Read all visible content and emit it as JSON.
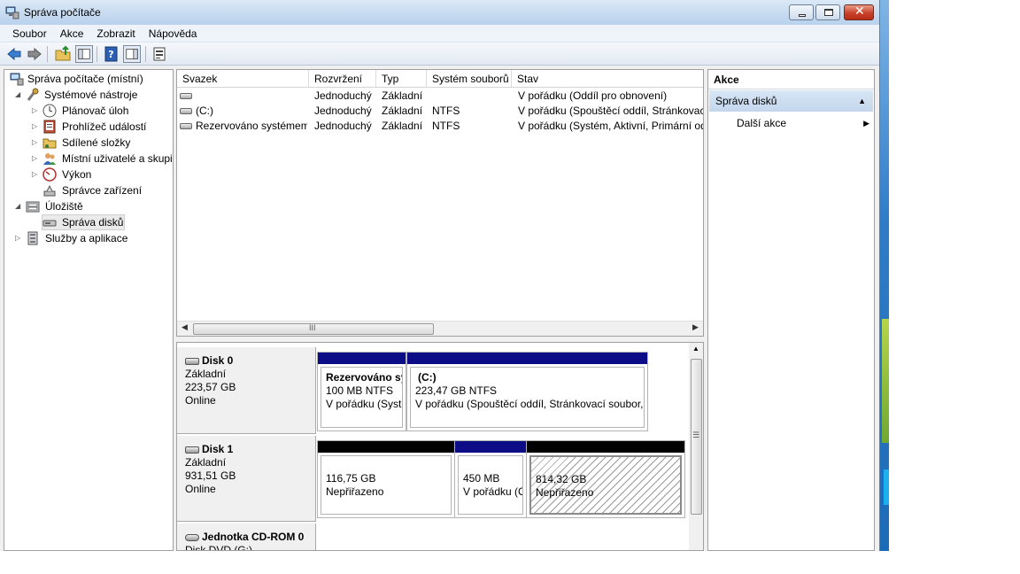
{
  "window": {
    "title": "Správa počítače"
  },
  "menu": [
    "Soubor",
    "Akce",
    "Zobrazit",
    "Nápověda"
  ],
  "tree": {
    "root": "Správa počítače (místní)",
    "system_tools": "Systémové nástroje",
    "task_scheduler": "Plánovač úloh",
    "event_viewer": "Prohlížeč událostí",
    "shared_folders": "Sdílené složky",
    "local_users": "Místní uživatelé a skupin",
    "performance": "Výkon",
    "device_manager": "Správce zařízení",
    "storage": "Úložiště",
    "disk_management": "Správa disků",
    "services_apps": "Služby a aplikace"
  },
  "volume_list": {
    "columns": [
      "Svazek",
      "Rozvržení",
      "Typ",
      "Systém souborů",
      "Stav"
    ],
    "rows": [
      {
        "volume": "",
        "layout": "Jednoduchý",
        "type": "Základní",
        "fs": "",
        "status": "V pořádku (Oddíl pro obnovení)"
      },
      {
        "volume": "(C:)",
        "layout": "Jednoduchý",
        "type": "Základní",
        "fs": "NTFS",
        "status": "V pořádku (Spouštěcí oddíl, Stránkovací"
      },
      {
        "volume": "Rezervováno systémem",
        "layout": "Jednoduchý",
        "type": "Základní",
        "fs": "NTFS",
        "status": "V pořádku (Systém, Aktivní, Primární od"
      }
    ],
    "scroll_grip": "III"
  },
  "disks": [
    {
      "name": "Disk 0",
      "kind": "Základní",
      "size": "223,57 GB",
      "state": "Online",
      "partitions": [
        {
          "title": "Rezervováno sy",
          "size": "100 MB NTFS",
          "status": "V pořádku (Syste",
          "bar_color": "#0c0c86"
        },
        {
          "title": "(C:)",
          "size": "223,47 GB NTFS",
          "status": "V pořádku (Spouštěcí oddíl, Stránkovací soubor, Y",
          "bar_color": "#0c0c86"
        }
      ]
    },
    {
      "name": "Disk 1",
      "kind": "Základní",
      "size": "931,51 GB",
      "state": "Online",
      "partitions": [
        {
          "title": "",
          "size": "116,75 GB",
          "status": "Nepřiřazeno",
          "bar_color": "#000000"
        },
        {
          "title": "",
          "size": "450 MB",
          "status": "V pořádku (O",
          "bar_color": "#0c0c86"
        },
        {
          "title": "",
          "size": "814,32 GB",
          "status": "Nepřiřazeno",
          "bar_color": "#000000"
        }
      ]
    },
    {
      "name": "Jednotka CD-ROM 0",
      "kind": "Disk DVD (G:)"
    }
  ],
  "actions": {
    "header": "Akce",
    "section": "Správa disků",
    "more": "Další akce"
  }
}
